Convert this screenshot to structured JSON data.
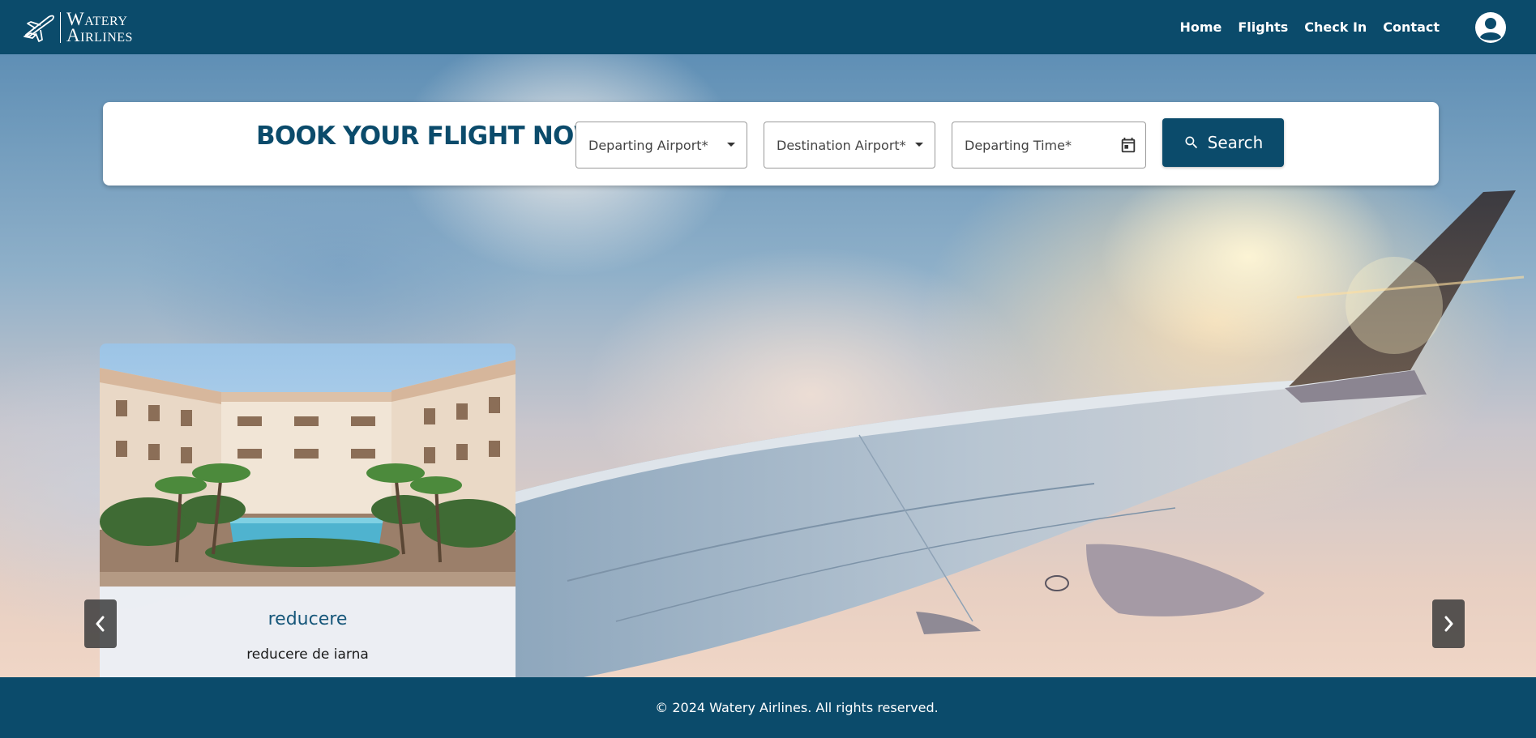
{
  "header": {
    "logo_line1": "Watery",
    "logo_line2": "Airlines",
    "nav": [
      "Home",
      "Flights",
      "Check In",
      "Contact"
    ],
    "account_icon": "user-circle-icon"
  },
  "booking": {
    "title": "BOOK YOUR FLIGHT NOW!",
    "departing_airport": "Departing Airport*",
    "destination_airport": "Destination Airport*",
    "departing_time": "Departing Time*",
    "search_label": "Search",
    "search_icon": "search-icon",
    "calendar_icon": "calendar-icon"
  },
  "promo": {
    "title": "reducere",
    "description": "reducere de iarna"
  },
  "carousel": {
    "prev_icon": "chevron-left-icon",
    "next_icon": "chevron-right-icon"
  },
  "footer": {
    "text": "© 2024 Watery Airlines. All rights reserved."
  },
  "colors": {
    "brand": "#0b4b6b",
    "card_caption_bg": "#ecf0f6"
  }
}
